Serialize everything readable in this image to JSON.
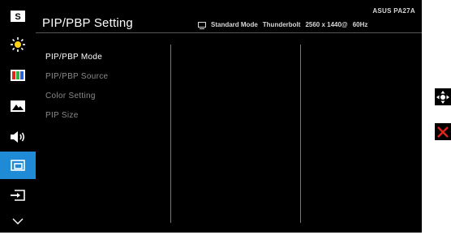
{
  "osd": {
    "title": "PIP/PBP Setting",
    "model": "ASUS PA27A",
    "status": {
      "mode": "Standard Mode",
      "input": "Thunderbolt",
      "resolution": "2560 x 1440@",
      "refresh": "60Hz"
    },
    "sidebar": [
      {
        "icon": "splendid-s-icon",
        "active": false
      },
      {
        "icon": "brightness-icon",
        "active": false
      },
      {
        "icon": "color-bars-icon",
        "active": false
      },
      {
        "icon": "image-icon",
        "active": false
      },
      {
        "icon": "sound-icon",
        "active": false
      },
      {
        "icon": "pip-pbp-icon",
        "active": true
      },
      {
        "icon": "input-select-icon",
        "active": false
      },
      {
        "icon": "chevron-down-icon",
        "active": false
      }
    ],
    "menu_items": [
      {
        "label": "PIP/PBP Mode",
        "active": true
      },
      {
        "label": "PIP/PBP Source",
        "active": false
      },
      {
        "label": "Color Setting",
        "active": false
      },
      {
        "label": "PIP Size",
        "active": false
      }
    ],
    "side_buttons": [
      "navigate-icon",
      "close-icon"
    ],
    "accent": "#1f8ad6",
    "close_color": "#e0251b"
  }
}
